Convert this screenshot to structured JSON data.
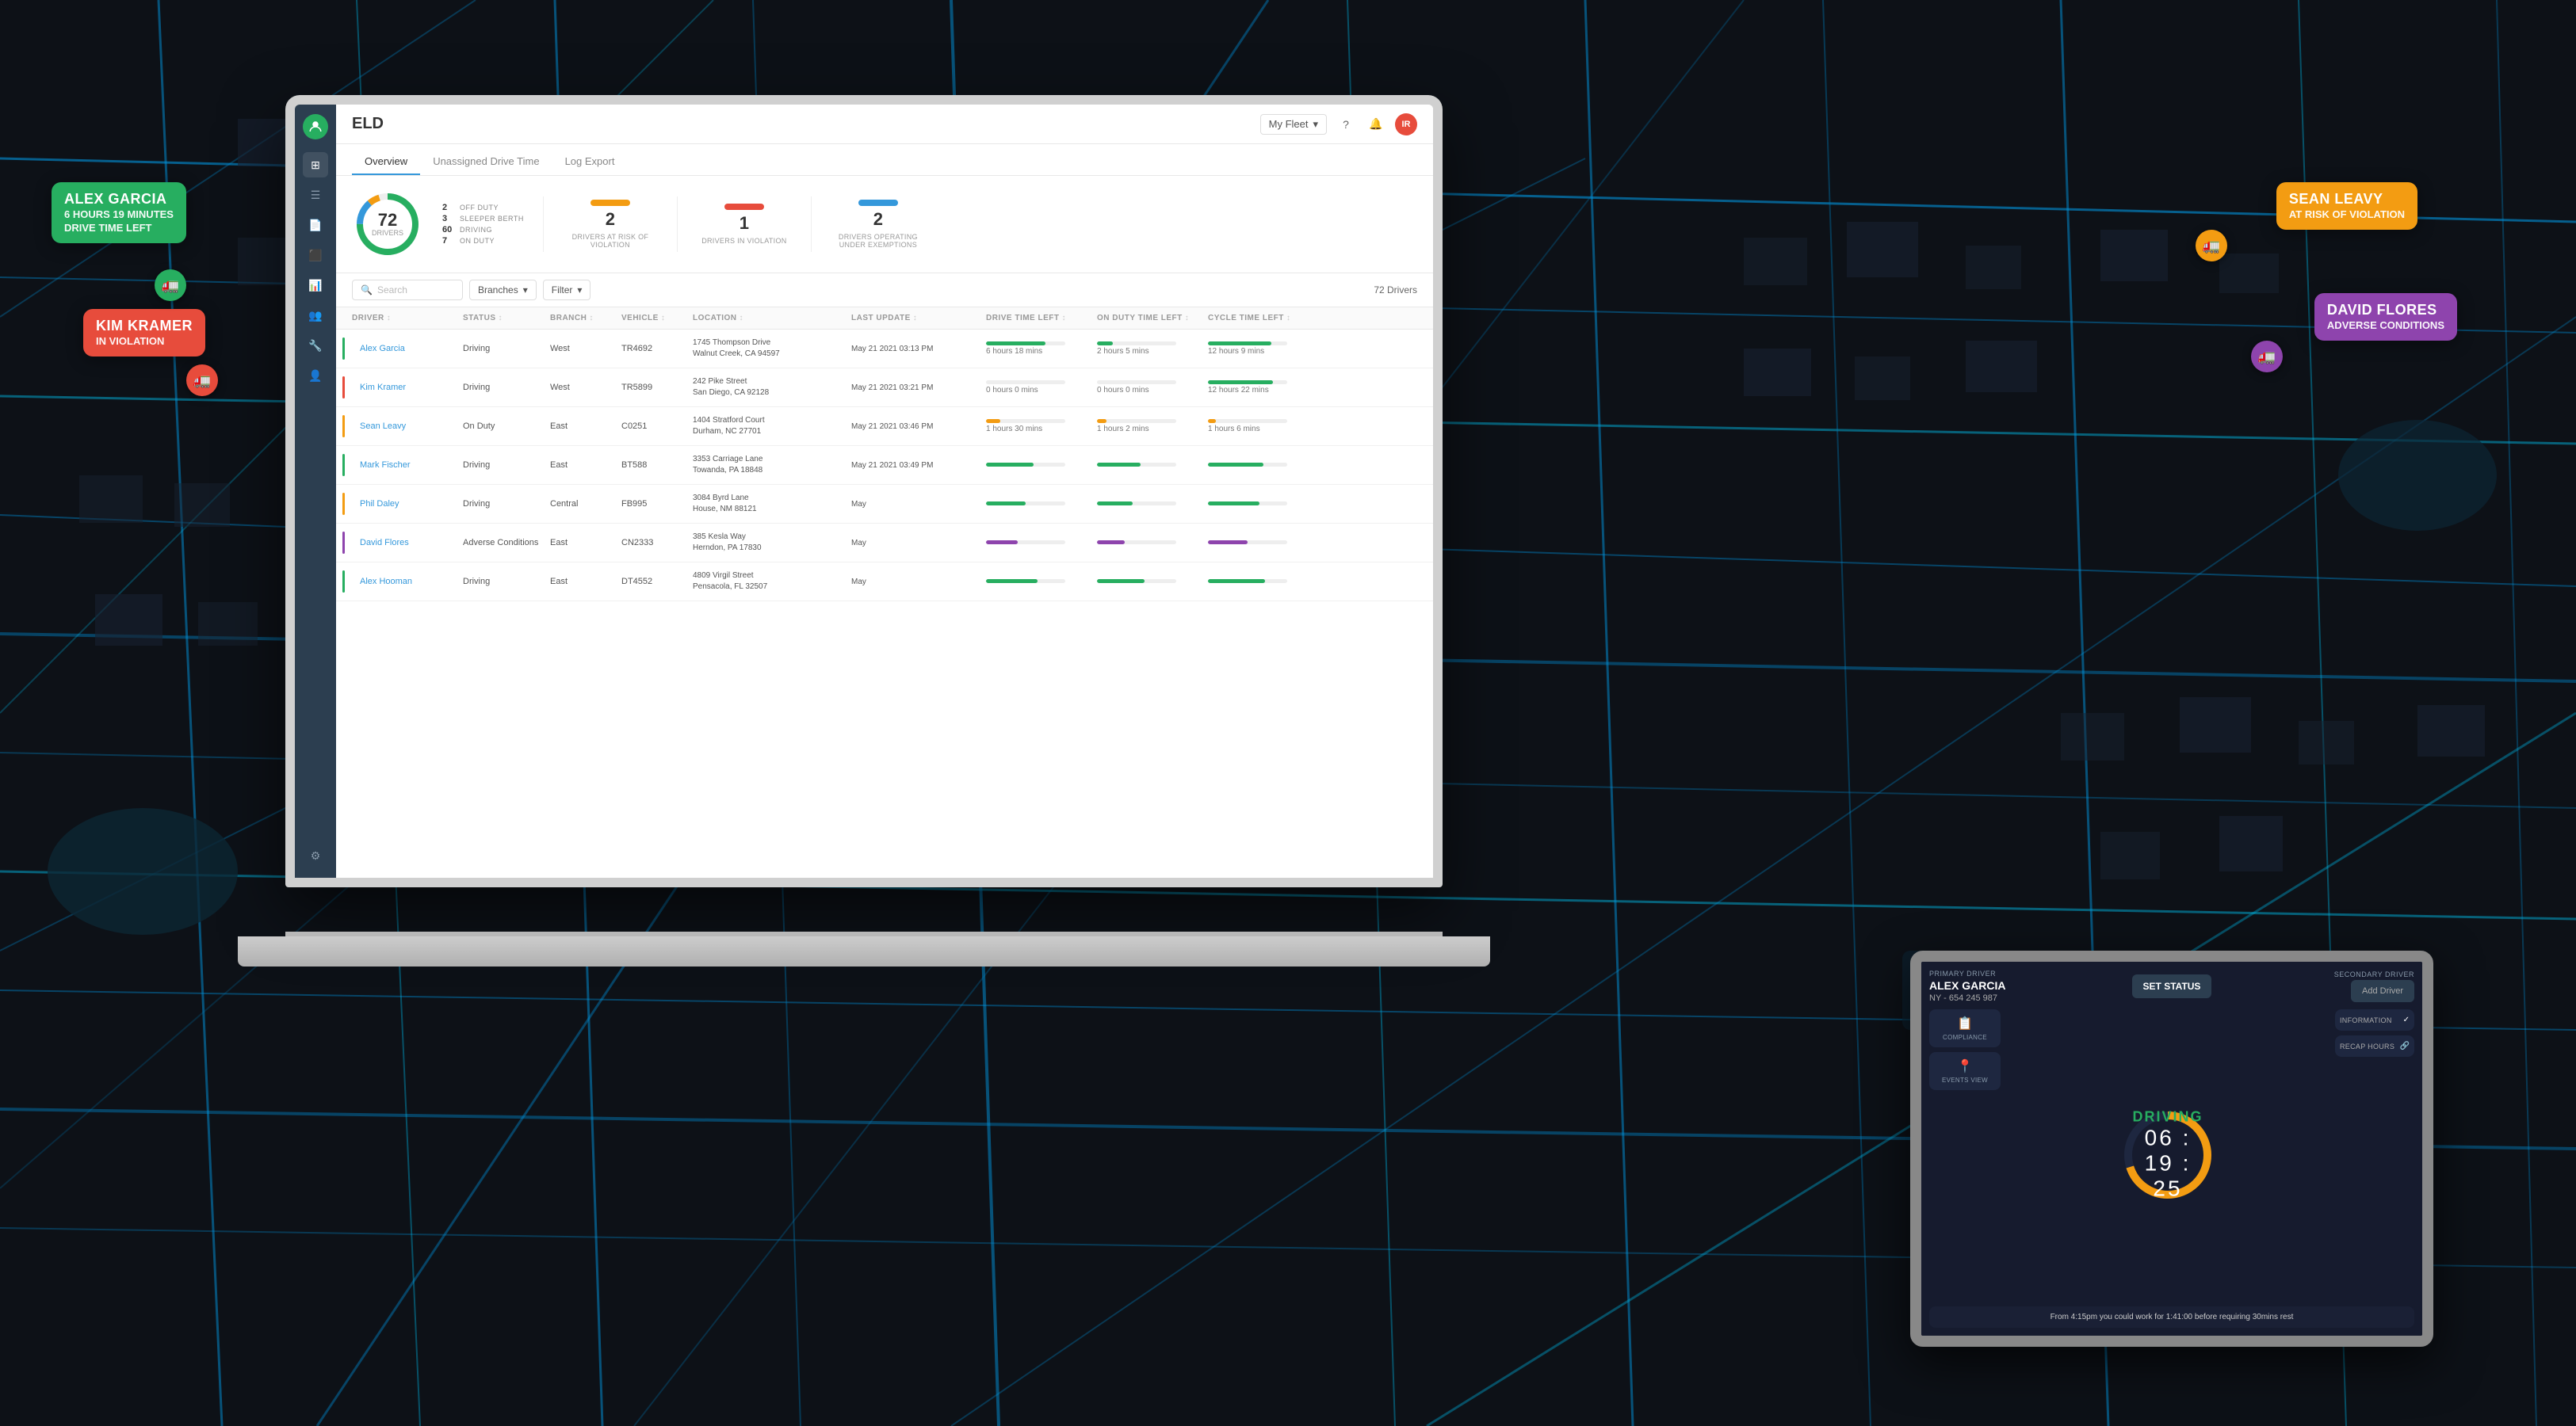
{
  "app": {
    "title": "ELD",
    "fleet": "My Fleet"
  },
  "header": {
    "title": "ELD",
    "fleet_label": "My Fleet",
    "icons": [
      "question",
      "bell",
      "user"
    ],
    "avatar_initials": "IR"
  },
  "tabs": [
    {
      "id": "overview",
      "label": "Overview",
      "active": true
    },
    {
      "id": "unassigned",
      "label": "Unassigned Drive Time",
      "active": false
    },
    {
      "id": "log_export",
      "label": "Log Export",
      "active": false
    }
  ],
  "stats": {
    "total_drivers": 72,
    "donut_label": "DRIVERS",
    "breakdown": [
      {
        "num": "2",
        "label": "OFF DUTY"
      },
      {
        "num": "3",
        "label": "SLEEPER BERTH"
      },
      {
        "num": "60",
        "label": "DRIVING"
      },
      {
        "num": "7",
        "label": "ON DUTY"
      }
    ],
    "stat_cards": [
      {
        "number": "2",
        "desc": "DRIVERS AT RISK OF VIOLATION",
        "color": "#f39c12"
      },
      {
        "number": "1",
        "desc": "DRIVERS IN VIOLATION",
        "color": "#e74c3c"
      },
      {
        "number": "2",
        "desc": "DRIVERS OPERATING UNDER EXEMPTIONS",
        "color": "#3498db"
      }
    ]
  },
  "toolbar": {
    "search_placeholder": "Search",
    "branch_label": "Branches",
    "filter_label": "Filter",
    "drivers_count": "72 Drivers"
  },
  "table": {
    "columns": [
      "DRIVER",
      "STATUS",
      "BRANCH",
      "VEHICLE",
      "LOCATION",
      "LAST UPDATE",
      "DRIVE TIME LEFT",
      "ON DUTY TIME LEFT",
      "CYCLE TIME LEFT"
    ],
    "rows": [
      {
        "driver": "Alex Garcia",
        "status": "Driving",
        "branch": "West",
        "vehicle": "TR4692",
        "location": "1745 Thompson Drive\nWalnut Creek, CA 94597",
        "last_update": "May 21 2021 03:13 PM",
        "drive_time": "6 hours 18 mins",
        "drive_pct": 75,
        "drive_color": "#27ae60",
        "on_duty": "2 hours 5 mins",
        "on_duty_pct": 20,
        "on_duty_color": "#27ae60",
        "cycle": "12 hours 9 mins",
        "cycle_pct": 80,
        "cycle_color": "#27ae60",
        "indicator_color": "#27ae60"
      },
      {
        "driver": "Kim Kramer",
        "status": "Driving",
        "branch": "West",
        "vehicle": "TR5899",
        "location": "242 Pike Street\nSan Diego, CA 92128",
        "last_update": "May 21 2021 03:21 PM",
        "drive_time": "0 hours 0 mins",
        "drive_pct": 0,
        "drive_color": "#e74c3c",
        "on_duty": "0 hours 0 mins",
        "on_duty_pct": 0,
        "on_duty_color": "#e74c3c",
        "cycle": "12 hours 22 mins",
        "cycle_pct": 82,
        "cycle_color": "#27ae60",
        "indicator_color": "#e74c3c"
      },
      {
        "driver": "Sean Leavy",
        "status": "On Duty",
        "branch": "East",
        "vehicle": "C0251",
        "location": "1404 Stratford Court\nDurham, NC 27701",
        "last_update": "May 21 2021 03:46 PM",
        "drive_time": "1 hours 30 mins",
        "drive_pct": 18,
        "drive_color": "#f39c12",
        "on_duty": "1 hours 2 mins",
        "on_duty_pct": 12,
        "on_duty_color": "#f39c12",
        "cycle": "1 hours 6 mins",
        "cycle_pct": 10,
        "cycle_color": "#f39c12",
        "indicator_color": "#f39c12"
      },
      {
        "driver": "Mark Fischer",
        "status": "Driving",
        "branch": "East",
        "vehicle": "BT588",
        "location": "3353 Carriage Lane\nTowanda, PA 18848",
        "last_update": "May 21 2021 03:49 PM",
        "drive_time": "",
        "drive_pct": 60,
        "drive_color": "#27ae60",
        "on_duty": "",
        "on_duty_pct": 55,
        "on_duty_color": "#27ae60",
        "cycle": "",
        "cycle_pct": 70,
        "cycle_color": "#27ae60",
        "indicator_color": "#27ae60"
      },
      {
        "driver": "Phil Daley",
        "status": "Driving",
        "branch": "Central",
        "vehicle": "FB995",
        "location": "3084 Byrd Lane\nHouse, NM 88121",
        "last_update": "May",
        "drive_time": "",
        "drive_pct": 50,
        "drive_color": "#27ae60",
        "on_duty": "",
        "on_duty_pct": 45,
        "on_duty_color": "#27ae60",
        "cycle": "",
        "cycle_pct": 65,
        "cycle_color": "#27ae60",
        "indicator_color": "#f39c12"
      },
      {
        "driver": "David Flores",
        "status": "Adverse Conditions",
        "branch": "East",
        "vehicle": "CN2333",
        "location": "385 Kesla Way\nHerndon, PA 17830",
        "last_update": "May",
        "drive_time": "",
        "drive_pct": 40,
        "drive_color": "#8e44ad",
        "on_duty": "",
        "on_duty_pct": 35,
        "on_duty_color": "#8e44ad",
        "cycle": "",
        "cycle_pct": 50,
        "cycle_color": "#8e44ad",
        "indicator_color": "#8e44ad"
      },
      {
        "driver": "Alex Hooman",
        "status": "Driving",
        "branch": "East",
        "vehicle": "DT4552",
        "location": "4809 Virgil Street\nPensacola, FL 32507",
        "last_update": "May",
        "drive_time": "",
        "drive_pct": 65,
        "drive_color": "#27ae60",
        "on_duty": "",
        "on_duty_pct": 60,
        "on_duty_color": "#27ae60",
        "cycle": "",
        "cycle_pct": 72,
        "cycle_color": "#27ae60",
        "indicator_color": "#27ae60"
      }
    ]
  },
  "tablet": {
    "primary_label": "PRIMARY DRIVER",
    "secondary_label": "SECONDARY DRIVER",
    "driver_name": "ALEX GARCIA",
    "driver_id": "NY - 654 245 987",
    "set_status_label": "SET STATUS",
    "add_driver_label": "Add Driver",
    "status": "DRIVING",
    "timer": "06 : 19 : 25",
    "compliance_label": "COMPLIANCE",
    "events_label": "EVENTS VIEW",
    "information_label": "INFORMATION",
    "recap_label": "RECAP HOURS",
    "footer_text": "From 4:15pm you could work for 1:41:00 before requiring 30mins rest"
  },
  "callouts": {
    "alex": {
      "name": "ALEX GARCIA",
      "line2": "6 HOURS 19 MINUTES",
      "line3": "DRIVE TIME LEFT"
    },
    "kim": {
      "name": "KIM KRAMER",
      "line2": "IN VIOLATION"
    },
    "sean": {
      "name": "SEAN LEAVY",
      "line2": "AT RISK OF VIOLATION"
    },
    "david": {
      "name": "DAVID FLORES",
      "line2": "ADVERSE CONDITIONS"
    }
  },
  "sidebar_icons": [
    "home",
    "list",
    "document",
    "layers",
    "settings",
    "person",
    "tools",
    "user"
  ]
}
